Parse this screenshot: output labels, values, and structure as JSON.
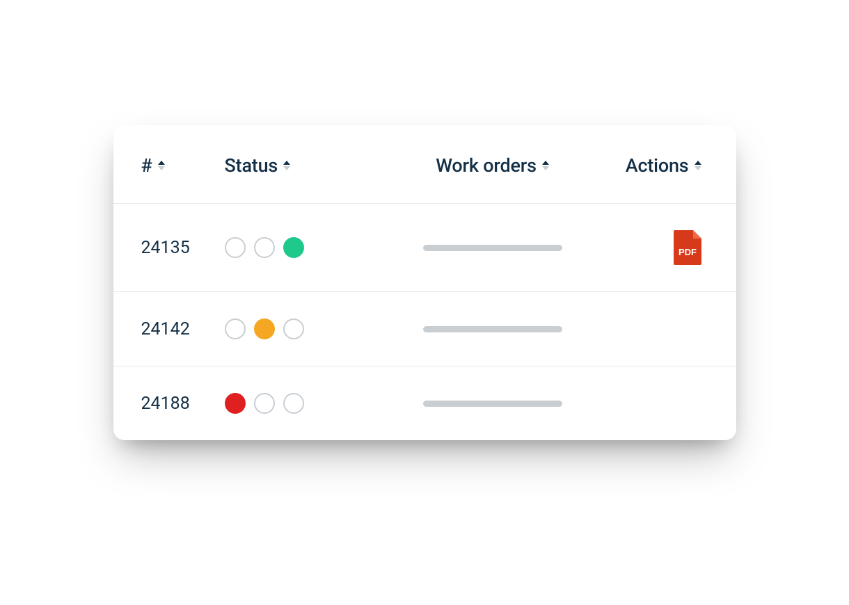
{
  "columns": {
    "number": "#",
    "status": "Status",
    "work_orders": "Work orders",
    "actions": "Actions"
  },
  "rows": [
    {
      "id": "24135",
      "status_active_index": 2,
      "status_color": "green",
      "has_pdf": true
    },
    {
      "id": "24142",
      "status_active_index": 1,
      "status_color": "orange",
      "has_pdf": false
    },
    {
      "id": "24188",
      "status_active_index": 0,
      "status_color": "red",
      "has_pdf": false
    }
  ],
  "icons": {
    "pdf_label": "PDF"
  },
  "colors": {
    "green": "#1ec98b",
    "orange": "#f5a623",
    "red": "#e02020",
    "text": "#143047",
    "muted": "#c9ced3",
    "pdf": "#d73a1a"
  }
}
